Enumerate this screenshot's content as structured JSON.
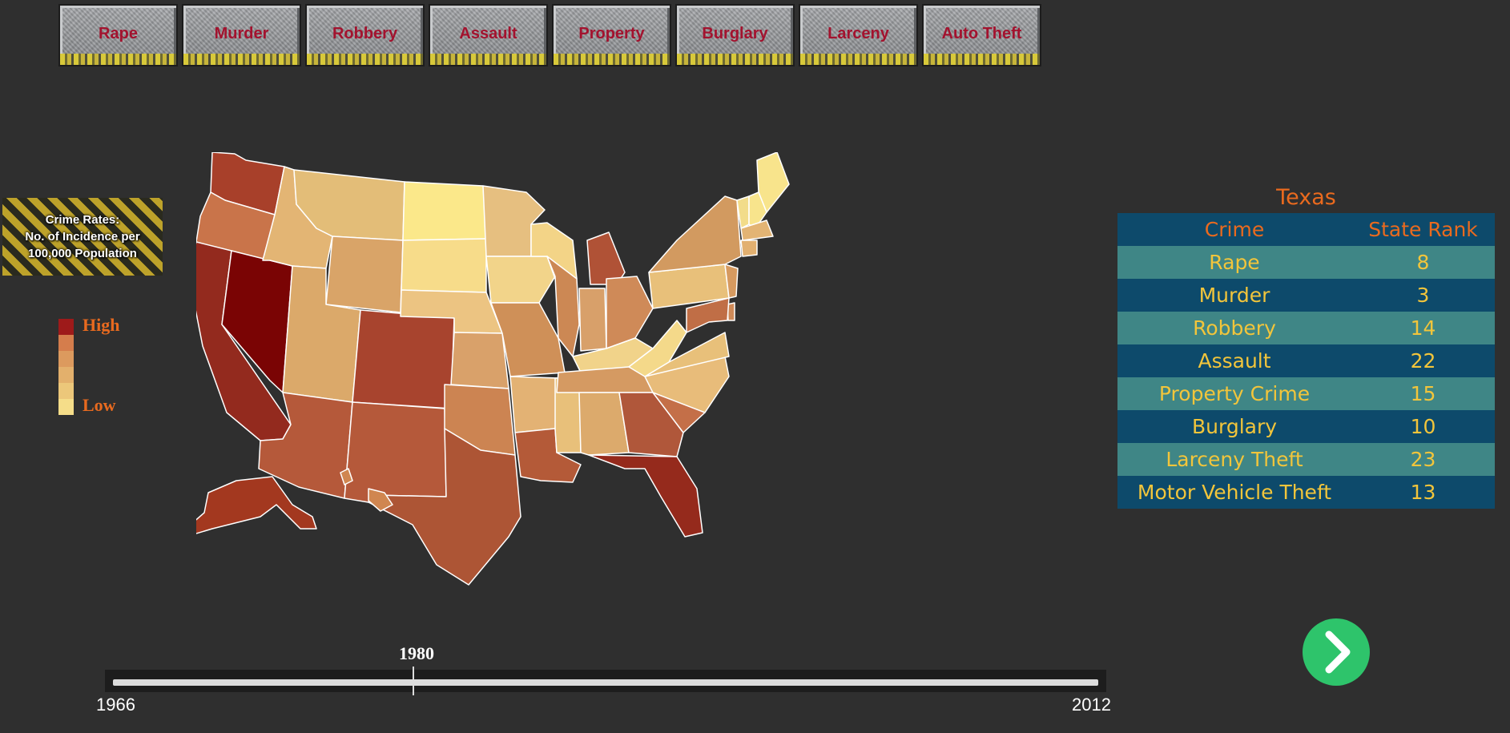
{
  "tabs": [
    "Rape",
    "Murder",
    "Robbery",
    "Assault",
    "Property",
    "Burglary",
    "Larceny",
    "Auto Theft"
  ],
  "legend": {
    "title_lines": [
      "Crime Rates:",
      "No. of Incidence per",
      "100,000 Population"
    ],
    "high": "High",
    "low": "Low",
    "colors": [
      "#9e1a1a",
      "#d57d4c",
      "#dc9a5e",
      "#e3b06c",
      "#ecc77a",
      "#f5dd89"
    ]
  },
  "map": {
    "state_colors": {
      "WA": "#a8402a",
      "OR": "#c9744a",
      "CA": "#932a1e",
      "NV": "#7a0404",
      "ID": "#e3b574",
      "MT": "#e3bd78",
      "WY": "#d9a468",
      "UT": "#dba96a",
      "AZ": "#b5593a",
      "CO": "#a8442e",
      "NM": "#b5593a",
      "ND": "#fbe88a",
      "SD": "#f7dc8a",
      "NE": "#ecc482",
      "KS": "#d9a16a",
      "OK": "#cc8452",
      "TX": "#ad5535",
      "MN": "#e6bf80",
      "IA": "#f2d48a",
      "MO": "#cf9058",
      "AR": "#e3b274",
      "LA": "#b45a38",
      "WI": "#f3d487",
      "IL": "#cc8854",
      "MS": "#e8c07a",
      "MI": "#b05236",
      "IN": "#d8a06a",
      "OH": "#cf8a58",
      "KY": "#f1d38a",
      "TN": "#d59a62",
      "AL": "#dcaa6c",
      "GA": "#b0573a",
      "FL": "#952a1c",
      "SC": "#c46f48",
      "NC": "#e8bc7a",
      "VA": "#e8c07a",
      "WV": "#f4d98a",
      "PA": "#e8c07a",
      "NY": "#d29a60",
      "ME": "#f8e48c",
      "VT": "#f2dc8a",
      "NH": "#f8e48c",
      "MA": "#e3b474",
      "CT": "#e2b070",
      "NJ": "#d69a60",
      "DE": "#cf8a58",
      "MD": "#c06e46",
      "AK": "#a3381f",
      "HI": "#d08650"
    },
    "state_names": {
      "WA": "Washington",
      "OR": "Oregon",
      "CA": "California",
      "NV": "Nevada",
      "ID": "Idaho",
      "MT": "Montana",
      "WY": "Wyoming",
      "UT": "Utah",
      "AZ": "Arizona",
      "CO": "Colorado",
      "NM": "New Mexico",
      "ND": "North Dakota",
      "SD": "South Dakota",
      "NE": "Nebraska",
      "KS": "Kansas",
      "OK": "Oklahoma",
      "TX": "Texas",
      "MN": "Minnesota",
      "IA": "Iowa",
      "MO": "Missouri",
      "AR": "Arkansas",
      "LA": "Louisiana",
      "WI": "Wisconsin",
      "IL": "Illinois",
      "MS": "Mississippi",
      "MI": "Michigan",
      "IN": "Indiana",
      "OH": "Ohio",
      "KY": "Kentucky",
      "TN": "Tennessee",
      "AL": "Alabama",
      "GA": "Georgia",
      "FL": "Florida",
      "SC": "South Carolina",
      "NC": "North Carolina",
      "VA": "Virginia",
      "WV": "West Virginia",
      "PA": "Pennsylvania",
      "NY": "New York",
      "ME": "Maine",
      "VT": "Vermont",
      "NH": "New Hampshire",
      "MA": "Massachusetts",
      "CT": "Connecticut",
      "NJ": "New Jersey",
      "DE": "Delaware",
      "MD": "Maryland",
      "AK": "Alaska",
      "HI": "Hawaii"
    }
  },
  "panel": {
    "state": "Texas",
    "headers": [
      "Crime",
      "State Rank"
    ],
    "rows": [
      [
        "Rape",
        "8"
      ],
      [
        "Murder",
        "3"
      ],
      [
        "Robbery",
        "14"
      ],
      [
        "Assault",
        "22"
      ],
      [
        "Property Crime",
        "15"
      ],
      [
        "Burglary",
        "10"
      ],
      [
        "Larceny Theft",
        "23"
      ],
      [
        "Motor Vehicle Theft",
        "13"
      ]
    ]
  },
  "slider": {
    "min": "1966",
    "max": "2012",
    "current": "1980",
    "min_value": 1966,
    "max_value": 2012,
    "current_value": 1980
  },
  "next_button": {
    "icon": "chevron-right-icon",
    "color": "#2ec46b"
  }
}
